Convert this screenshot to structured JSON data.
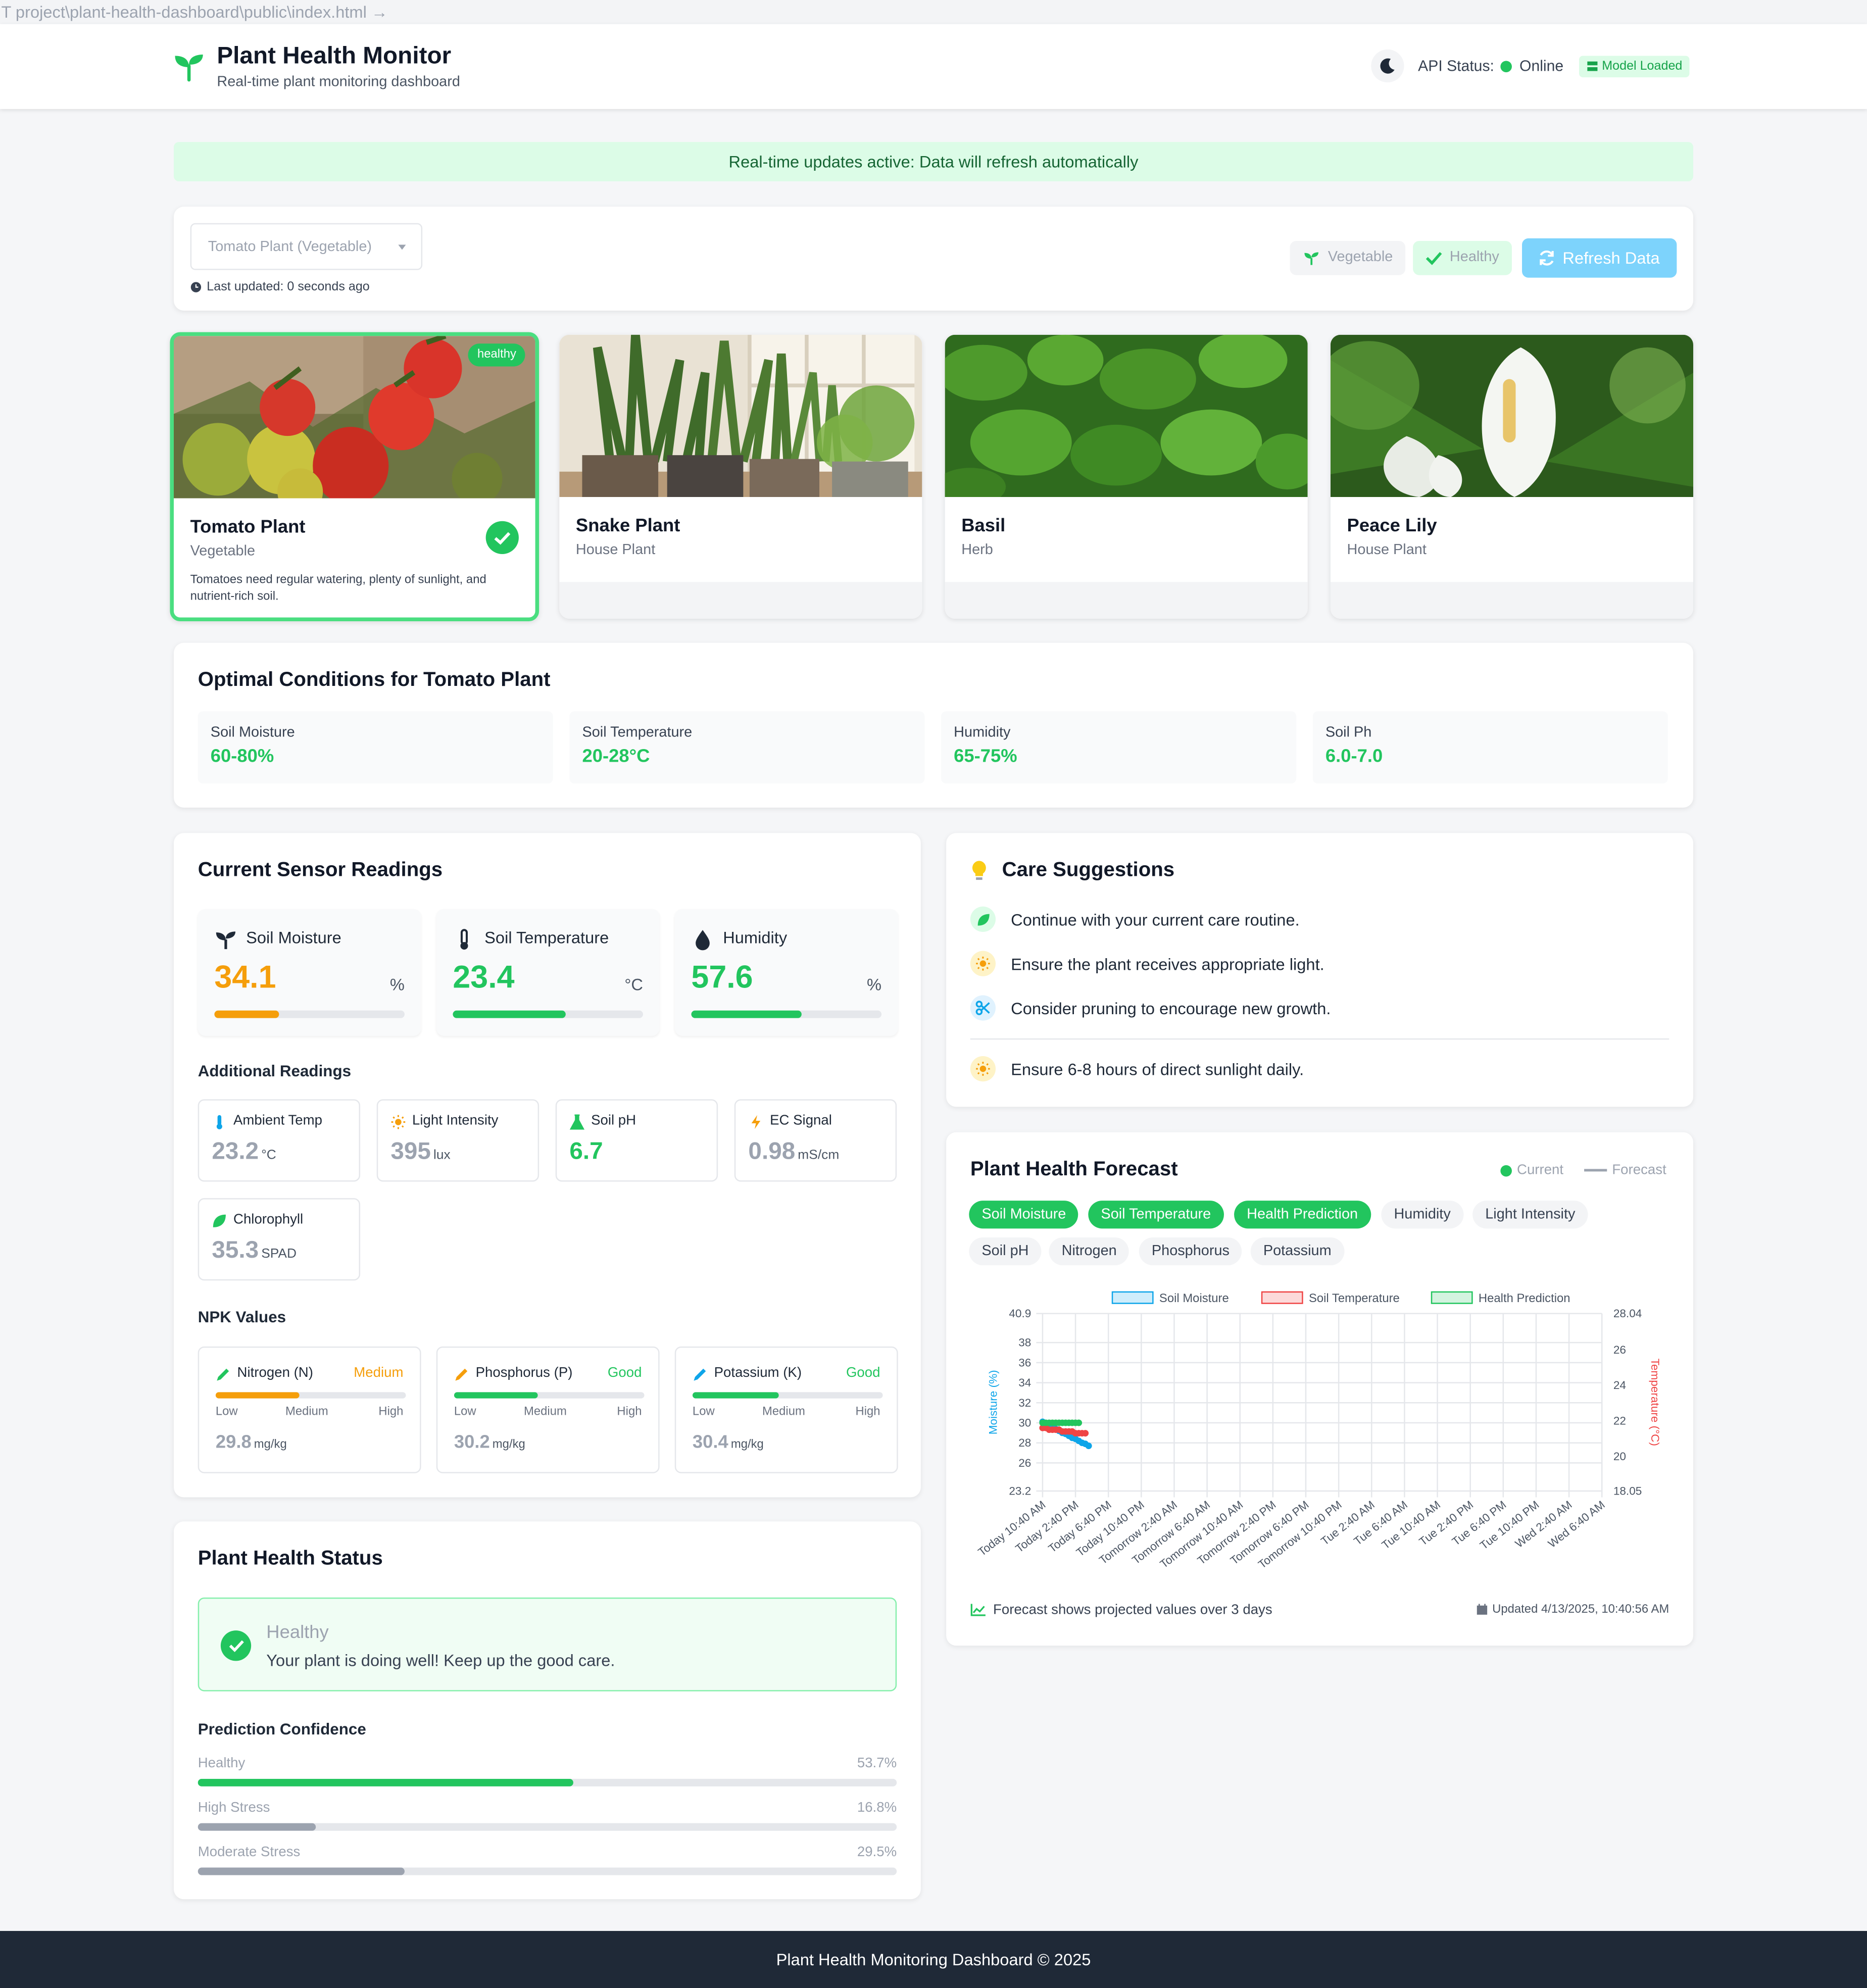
{
  "path_bar": "T project\\plant-health-dashboard\\public\\index.html  →",
  "header": {
    "title": "Plant Health Monitor",
    "subtitle": "Real-time plant monitoring dashboard",
    "api_label": "API Status:",
    "api_status": "Online",
    "model_badge": "Model Loaded",
    "colors": {
      "brand": "#22c55e",
      "online": "#22c55e"
    }
  },
  "banner": "Real-time updates active: Data will refresh automatically",
  "controls": {
    "select_value": "Tomato Plant (Vegetable)",
    "last_updated": "Last updated: 0 seconds ago",
    "type_pill": "Vegetable",
    "health_pill": "Healthy",
    "refresh_button": "Refresh Data"
  },
  "plants": [
    {
      "name": "Tomato Plant",
      "type": "Vegetable",
      "badge": "healthy",
      "description": "Tomatoes need regular watering, plenty of sunlight, and nutrient-rich soil.",
      "selected": true
    },
    {
      "name": "Snake Plant",
      "type": "House Plant"
    },
    {
      "name": "Basil",
      "type": "Herb"
    },
    {
      "name": "Peace Lily",
      "type": "House Plant"
    }
  ],
  "optimal": {
    "title": "Optimal Conditions for Tomato Plant",
    "items": [
      {
        "label": "Soil Moisture",
        "value": "60-80%"
      },
      {
        "label": "Soil Temperature",
        "value": "20-28°C"
      },
      {
        "label": "Humidity",
        "value": "65-75%"
      },
      {
        "label": "Soil Ph",
        "value": "6.0-7.0"
      }
    ]
  },
  "sensors": {
    "title": "Current Sensor Readings",
    "main": [
      {
        "label": "Soil Moisture",
        "value": "34.1",
        "unit": "%",
        "level": 0.34,
        "color": "#f59e0b",
        "icon": "seedling-icon"
      },
      {
        "label": "Soil Temperature",
        "value": "23.4",
        "unit": "°C",
        "level": 0.59,
        "color": "#22c55e",
        "icon": "thermometer-icon"
      },
      {
        "label": "Humidity",
        "value": "57.6",
        "unit": "%",
        "level": 0.58,
        "color": "#22c55e",
        "icon": "droplet-icon"
      }
    ],
    "additional_title": "Additional Readings",
    "additional": [
      {
        "label": "Ambient Temp",
        "value": "23.2",
        "unit": "°C",
        "icon": "thermometer-icon"
      },
      {
        "label": "Light Intensity",
        "value": "395",
        "unit": "lux",
        "icon": "sun-icon"
      },
      {
        "label": "Soil pH",
        "value": "6.7",
        "unit": "",
        "icon": "flask-icon"
      },
      {
        "label": "EC Signal",
        "value": "0.98",
        "unit": "mS/cm",
        "icon": "bolt-icon"
      },
      {
        "label": "Chlorophyll",
        "value": "35.3",
        "unit": "SPAD",
        "icon": "leaf-icon"
      }
    ],
    "npk_title": "NPK Values",
    "npk": [
      {
        "label": "Nitrogen (N)",
        "level_text": "Medium",
        "level_color": "#f59e0b",
        "fill": 0.44,
        "value": "29.8",
        "unit": "mg/kg",
        "bar_color": "#f59e0b"
      },
      {
        "label": "Phosphorus (P)",
        "level_text": "Good",
        "level_color": "#22c55e",
        "fill": 0.44,
        "value": "30.2",
        "unit": "mg/kg",
        "bar_color": "#22c55e"
      },
      {
        "label": "Potassium (K)",
        "level_text": "Good",
        "level_color": "#22c55e",
        "fill": 0.45,
        "value": "30.4",
        "unit": "mg/kg",
        "bar_color": "#22c55e"
      }
    ],
    "scale": {
      "low": "Low",
      "medium": "Medium",
      "high": "High"
    }
  },
  "care": {
    "title": "Care Suggestions",
    "items": [
      {
        "text": "Continue with your current care routine.",
        "icon": "leaf-icon"
      },
      {
        "text": "Ensure the plant receives appropriate light.",
        "icon": "sun-icon"
      },
      {
        "text": "Consider pruning to encourage new growth.",
        "icon": "scissors-icon"
      },
      {
        "text": "Ensure 6-8 hours of direct sunlight daily.",
        "icon": "sun-icon"
      }
    ]
  },
  "forecast": {
    "title": "Plant Health Forecast",
    "legend_current": "Current",
    "legend_forecast": "Forecast",
    "chips": [
      {
        "label": "Soil Moisture",
        "active": true
      },
      {
        "label": "Soil Temperature",
        "active": true
      },
      {
        "label": "Health Prediction",
        "active": true
      },
      {
        "label": "Humidity",
        "active": false
      },
      {
        "label": "Light Intensity",
        "active": false
      },
      {
        "label": "Soil pH",
        "active": false
      },
      {
        "label": "Nitrogen",
        "active": false
      },
      {
        "label": "Phosphorus",
        "active": false
      },
      {
        "label": "Potassium",
        "active": false
      }
    ],
    "footer_note": "Forecast shows projected values over 3 days",
    "updated": "Updated 4/13/2025, 10:40:56 AM"
  },
  "chart_data": {
    "type": "line",
    "x": [
      "Today 10:40 AM",
      "Today 2:40 PM",
      "Today 6:40 PM",
      "Today 10:40 PM",
      "Tomorrow 2:40 AM",
      "Tomorrow 6:40 AM",
      "Tomorrow 10:40 AM",
      "Tomorrow 2:40 PM",
      "Tomorrow 6:40 PM",
      "Tomorrow 10:40 PM",
      "Tue 2:40 AM",
      "Tue 6:40 AM",
      "Tue 10:40 AM",
      "Tue 2:40 PM",
      "Tue 6:40 PM",
      "Tue 10:40 PM",
      "Wed 2:40 AM",
      "Wed 6:40 AM"
    ],
    "series": [
      {
        "name": "Soil Moisture",
        "axis": "left",
        "color": "#0ea5e9",
        "x": [
          0,
          0.1,
          0.2,
          0.3,
          0.4,
          0.5,
          0.6,
          0.7,
          0.8,
          0.9,
          1.0,
          1.1,
          1.2,
          1.3,
          1.4
        ],
        "values": [
          30.1,
          29.9,
          29.7,
          29.5,
          29.4,
          29.2,
          29.0,
          28.9,
          28.7,
          28.5,
          28.4,
          28.2,
          28.0,
          27.9,
          27.7
        ]
      },
      {
        "name": "Soil Temperature",
        "axis": "right",
        "color": "#ef4444",
        "x": [
          0,
          0.1,
          0.2,
          0.3,
          0.4,
          0.5,
          0.6,
          0.7,
          0.8,
          0.9,
          1.0,
          1.1,
          1.2,
          1.3
        ],
        "values": [
          21.6,
          21.6,
          21.5,
          21.5,
          21.5,
          21.5,
          21.4,
          21.4,
          21.4,
          21.4,
          21.3,
          21.3,
          21.3,
          21.3
        ]
      },
      {
        "name": "Health Prediction",
        "axis": "left",
        "color": "#22c55e",
        "x": [
          0,
          0.1,
          0.2,
          0.3,
          0.4,
          0.5,
          0.6,
          0.7,
          0.8,
          0.9,
          1.0,
          1.1
        ],
        "values": [
          30.0,
          30.0,
          30.0,
          30.0,
          30.0,
          30.0,
          30.0,
          30.0,
          30.0,
          30.0,
          30.0,
          30.0
        ]
      }
    ],
    "y_left": {
      "label": "Moisture (%)",
      "min": 23.2,
      "max": 40.9,
      "ticks": [
        "40.9",
        "38",
        "36",
        "34",
        "32",
        "30",
        "28",
        "26",
        "23.2"
      ],
      "tick_values": [
        40.9,
        38,
        36,
        34,
        32,
        30,
        28,
        26,
        23.2
      ]
    },
    "y_right": {
      "label": "Temperature (°C)",
      "min": 18.05,
      "max": 28.04,
      "ticks": [
        "28.04",
        "26",
        "24",
        "22",
        "20",
        "18.05"
      ],
      "tick_values": [
        28.04,
        26,
        24,
        22,
        20,
        18.05
      ]
    },
    "legend_position": "top",
    "grid": true
  },
  "health": {
    "title": "Plant Health Status",
    "status": "Healthy",
    "message": "Your plant is doing well! Keep up the good care.",
    "confidence_title": "Prediction Confidence",
    "confidence": [
      {
        "label": "Healthy",
        "pct": "53.7%",
        "value": 0.537,
        "color": "#22c55e"
      },
      {
        "label": "High Stress",
        "pct": "16.8%",
        "value": 0.168,
        "color": "#9ca3af"
      },
      {
        "label": "Moderate Stress",
        "pct": "29.5%",
        "value": 0.295,
        "color": "#9ca3af"
      }
    ]
  },
  "footer": "Plant Health Monitoring Dashboard © 2025"
}
